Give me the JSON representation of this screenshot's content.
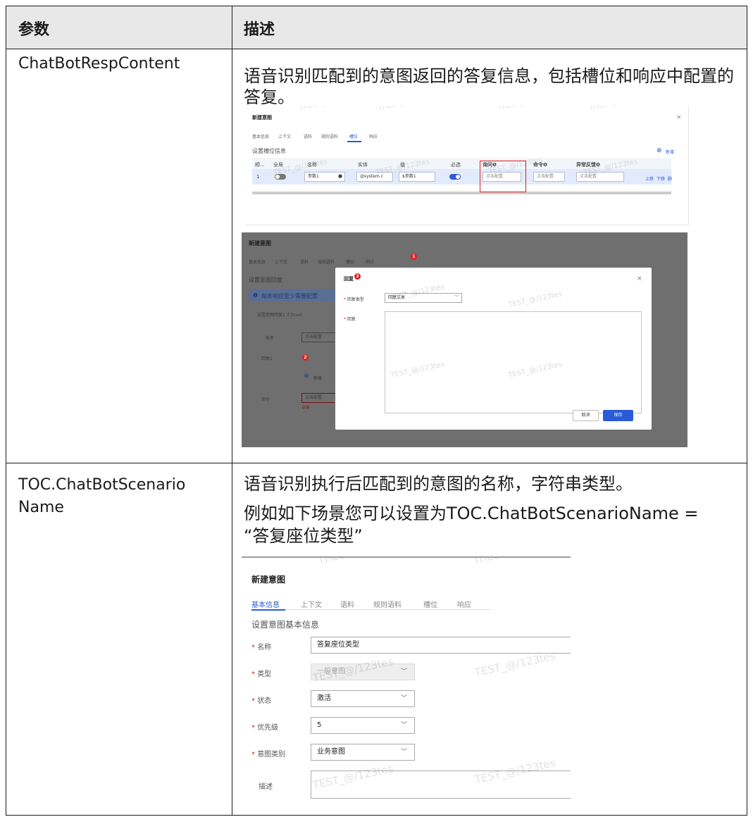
{
  "table": {
    "header": {
      "param": "参数",
      "desc": "描述"
    },
    "rows": [
      {
        "param": "ChatBotRespContent",
        "desc": "语音识别匹配到的意图返回的答复信息，包括槽位和响应中配置的答复。"
      },
      {
        "param_line1": "TOC.ChatBotScenario",
        "param_line2": "Name",
        "desc_line1": "语音识别执行后匹配到的意图的名称，字符串类型。",
        "desc_line2": "例如如下场景您可以设置为TOC.ChatBotScenarioName =",
        "desc_line3": "“答复座位类型”"
      }
    ]
  },
  "watermark": {
    "line1": "TEST_@/123tes",
    "line2": "ITIES-@"
  },
  "shot_slot": {
    "title": "新建意图",
    "tabs": [
      "基本信息",
      "上下文",
      "语料",
      "规则语料",
      "槽位",
      "响应"
    ],
    "active_tab": "槽位",
    "section": "设置槽位信息",
    "add_label": "新增",
    "columns": [
      "顺...",
      "全局",
      "名称",
      "实体",
      "值",
      "必选",
      "询问❶",
      "命令❶",
      "异常反馈❶"
    ],
    "row": {
      "index": "1",
      "name": "参数1",
      "entity": "@system.c",
      "value": "$参数1",
      "ask": "点击配置",
      "command": "点击配置",
      "feedback": "点击配置",
      "up": "上移",
      "down": "下移",
      "more": "删"
    },
    "close": "×"
  },
  "shot_response": {
    "title": "新建意图",
    "tabs": [
      "基本信息",
      "上下文",
      "语料",
      "规则语料",
      "槽位",
      "响应"
    ],
    "section": "设置意图回复",
    "info": "每条响应至少需要配置",
    "collapse": "设置意图回复1 if (true)",
    "cond_label": "条件",
    "cond_value": "点击配置",
    "reply1_label": "回复1",
    "add_label": "新增",
    "cmd_label": "命令",
    "cmd_value": "点击配置",
    "required": "必填",
    "badges": [
      "1",
      "2",
      "3"
    ],
    "dialog": {
      "title": "回复",
      "close": "×",
      "type_label": "回复类型",
      "type_value": "回复文本",
      "reply_label": "回复",
      "cancel": "取消",
      "save": "保存"
    }
  },
  "shot_basic": {
    "title": "新建意图",
    "tabs": [
      "基本信息",
      "上下文",
      "语料",
      "规则语料",
      "槽位",
      "响应"
    ],
    "section": "设置意图基本信息",
    "fields": [
      {
        "label": "名称",
        "value": "答复座位类型"
      },
      {
        "label": "类型",
        "value": "一般意图"
      },
      {
        "label": "状态",
        "value": "激活"
      },
      {
        "label": "优先级",
        "value": "5"
      },
      {
        "label": "意图类别",
        "value": "业务意图"
      },
      {
        "label": "描述",
        "value": ""
      }
    ]
  },
  "colors": {
    "accent": "#2a5bd7",
    "highlight": "#e02020",
    "header_bg": "#e8e8e8"
  }
}
